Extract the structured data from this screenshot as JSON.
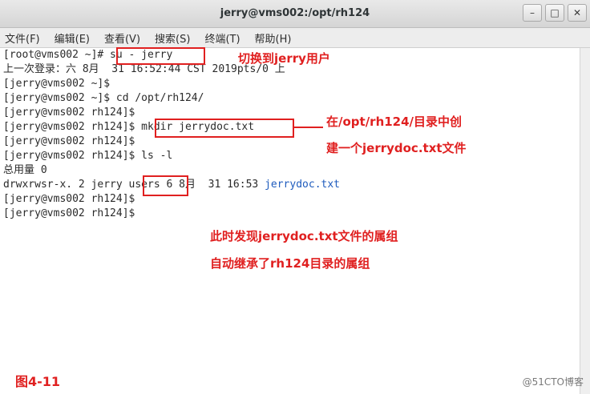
{
  "window": {
    "title": "jerry@vms002:/opt/rh124",
    "controls": [
      "minimize",
      "maximize",
      "close"
    ]
  },
  "menu": [
    "文件(F)",
    "编辑(E)",
    "查看(V)",
    "搜索(S)",
    "终端(T)",
    "帮助(H)"
  ],
  "terminal_lines": [
    "[root@vms002 ~]# su - jerry",
    "上一次登录：六 8月  31 16:52:44 CST 2019pts/0 上",
    "[jerry@vms002 ~]$",
    "[jerry@vms002 ~]$ cd /opt/rh124/",
    "[jerry@vms002 rh124]$",
    "[jerry@vms002 rh124]$ mkdir jerrydoc.txt",
    "[jerry@vms002 rh124]$",
    "[jerry@vms002 rh124]$ ls -l",
    "总用量 0",
    "drwxrwsr-x. 2 jerry users 6 8月  31 16:53 ",
    "[jerry@vms002 rh124]$",
    "[jerry@vms002 rh124]$"
  ],
  "listing_filename": "jerrydoc.txt",
  "annotations": {
    "switch_user": "切换到jerry用户",
    "mkdir_note_1": "在/opt/rh124/目录中创",
    "mkdir_note_2": "建一个jerrydoc.txt文件",
    "group_note_1": "此时发现jerrydoc.txt文件的属组",
    "group_note_2": "自动继承了rh124目录的属组"
  },
  "figure_label": "图4-11",
  "watermark": "@51CTO博客",
  "colors": {
    "highlight": "#e02020",
    "link": "#1e5bbd"
  }
}
